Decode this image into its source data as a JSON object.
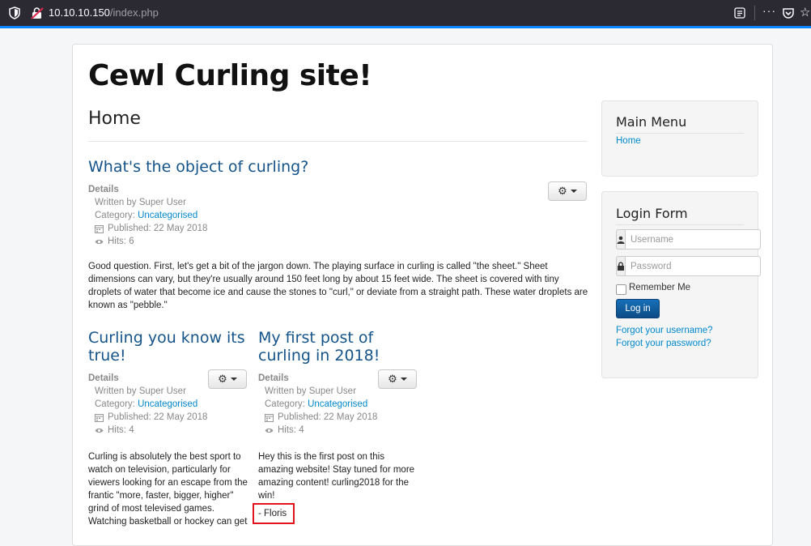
{
  "browser": {
    "host": "10.10.10.150",
    "path": "/index.php",
    "more_label": "···",
    "star_glyph": "☆"
  },
  "site": {
    "title": "Cewl Curling site!",
    "page_heading": "Home"
  },
  "articles": [
    {
      "title": "What's the object of curling?",
      "details_label": "Details",
      "author": "Written by Super User",
      "category_label": "Category: ",
      "category": "Uncategorised",
      "published": "Published: 22 May 2018",
      "hits": "Hits: 6",
      "text": "Good question. First, let's get a bit of the jargon down. The playing surface in curling is called \"the sheet.\" Sheet dimensions can vary, but they're usually around 150 feet long by about 15 feet wide. The sheet is covered with tiny droplets of water that become ice and cause the stones to \"curl,\" or deviate from a straight path. These water droplets are known as \"pebble.\""
    },
    {
      "title": "Curling you know its true!",
      "details_label": "Details",
      "author": "Written by Super User",
      "category_label": "Category: ",
      "category": "Uncategorised",
      "published": "Published: 22 May 2018",
      "hits": "Hits: 4",
      "text": "Curling is absolutely the best sport to watch on television, particularly for viewers looking for an escape from the frantic \"more, faster, bigger, higher\" grind of most televised games. Watching basketball or hockey can get"
    },
    {
      "title": "My first post of curling in 2018!",
      "details_label": "Details",
      "author": "Written by Super User",
      "category_label": "Category: ",
      "category": "Uncategorised",
      "published": "Published: 22 May 2018",
      "hits": "Hits: 4",
      "text": "Hey this is the first post on this amazing website! Stay tuned for more amazing content! curling2018 for the win!",
      "signature": "- Floris"
    }
  ],
  "sidebar": {
    "main_menu": {
      "title": "Main Menu",
      "items": [
        {
          "label": "Home"
        }
      ]
    },
    "login": {
      "title": "Login Form",
      "username_placeholder": "Username",
      "password_placeholder": "Password",
      "remember_label": "Remember Me",
      "submit_label": "Log in",
      "forgot_username": "Forgot your username?",
      "forgot_password": "Forgot your password?"
    }
  },
  "colors": {
    "link": "#0088cc",
    "title": "#15548a",
    "highlight_box": "#e3131b",
    "primary_button": "#0d4b85"
  }
}
